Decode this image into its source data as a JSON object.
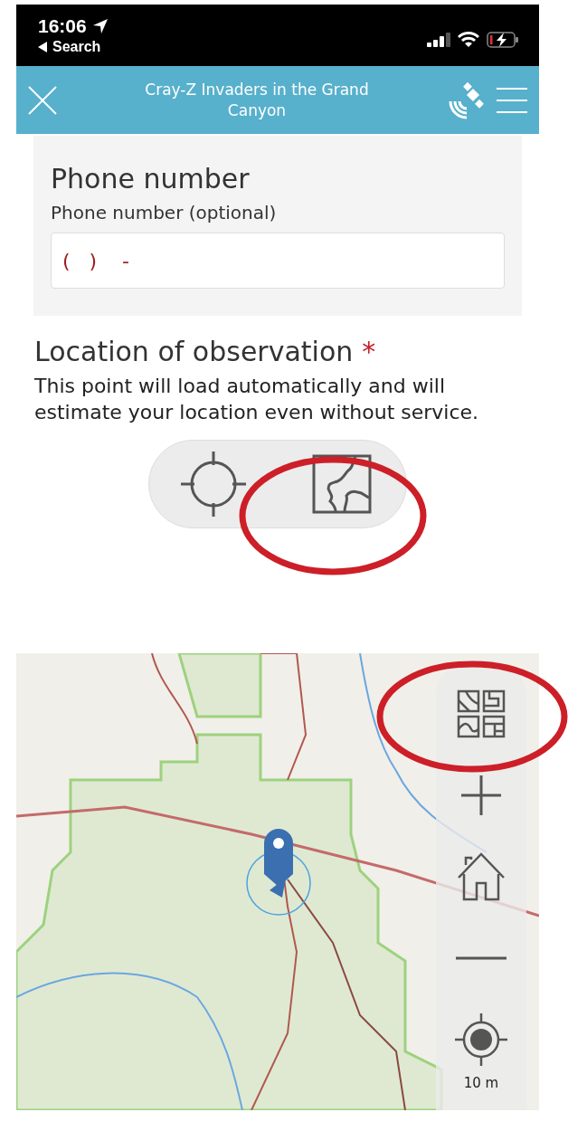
{
  "status_bar": {
    "time": "16:06",
    "back_label": "Search"
  },
  "header": {
    "title": "Cray-Z Invaders in the Grand Canyon"
  },
  "phone_question": {
    "title": "Phone number",
    "label": "Phone number (optional)",
    "placeholder": "(   )    -"
  },
  "location_question": {
    "label": "Location of observation",
    "required_mark": "*",
    "hint": "This point will load automatically and will estimate your location even without service."
  },
  "map": {
    "accuracy": "10 m"
  }
}
